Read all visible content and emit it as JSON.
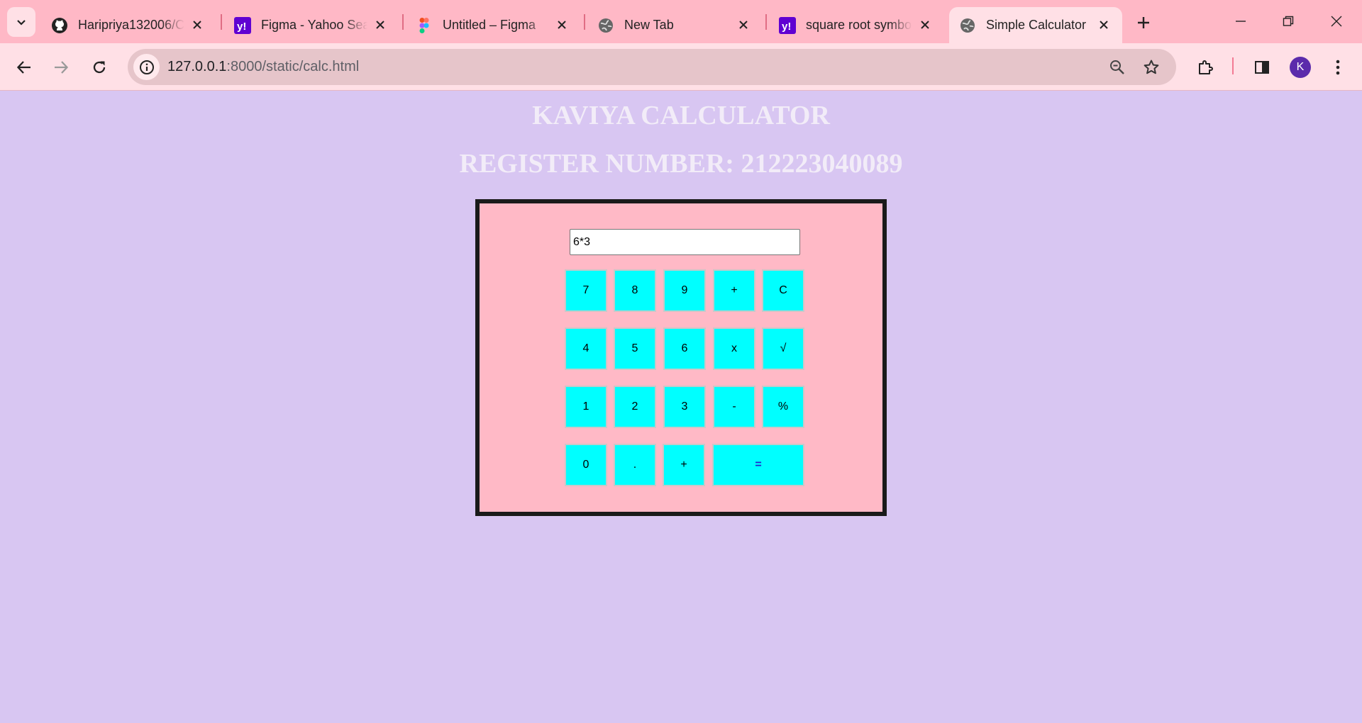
{
  "browser": {
    "tabs": [
      {
        "title": "Haripriya132006/C",
        "favicon": "github-icon",
        "active": false
      },
      {
        "title": "Figma - Yahoo Sea",
        "favicon": "yahoo-icon",
        "active": false
      },
      {
        "title": "Untitled – Figma",
        "favicon": "figma-icon",
        "active": false
      },
      {
        "title": "New Tab",
        "favicon": "globe-icon",
        "active": false
      },
      {
        "title": "square root symbo",
        "favicon": "yahoo-icon",
        "active": false
      },
      {
        "title": "Simple Calculator",
        "favicon": "globe-icon",
        "active": true
      }
    ],
    "address": {
      "host": "127.0.0.1",
      "path": ":8000/static/calc.html"
    },
    "profile_initial": "K"
  },
  "page": {
    "title": "KAVIYA CALCULATOR",
    "register": "REGISTER NUMBER: 212223040089",
    "display_value": "6*3",
    "keys": {
      "k7": "7",
      "k8": "8",
      "k9": "9",
      "kplus1": "+",
      "kclear": "C",
      "k4": "4",
      "k5": "5",
      "k6": "6",
      "kmul": "x",
      "ksqrt": "√",
      "k1": "1",
      "k2": "2",
      "k3": "3",
      "kminus": "-",
      "kpct": "%",
      "k0": "0",
      "kdot": ".",
      "kplus2": "+",
      "keq": "="
    }
  },
  "colors": {
    "page_bg": "#d8c6f2",
    "calc_bg": "#ffb9c6",
    "key_bg": "#00ffff",
    "tabstrip_bg": "#ffb8c6",
    "toolbar_bg": "#ffe0e6"
  }
}
